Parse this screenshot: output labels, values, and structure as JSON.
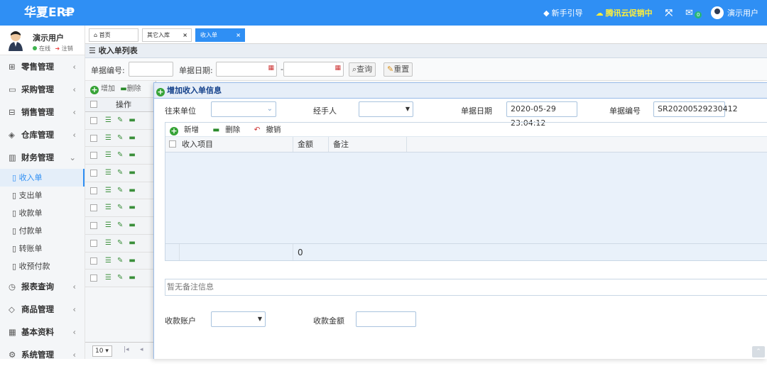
{
  "app": {
    "brand": "华夏ERP",
    "menu_toggle": "≡"
  },
  "topbar": {
    "guide": "新手引导",
    "promo": "腾讯云促销中",
    "mail_badge": "0",
    "user": "演示用户"
  },
  "user": {
    "name": "演示用户",
    "online": "在线",
    "logout": "注销"
  },
  "sidebar": {
    "groups": [
      {
        "label": "零售管理",
        "icon": "gift-icon",
        "glyph": "⊞"
      },
      {
        "label": "采购管理",
        "icon": "monitor-icon",
        "glyph": "▭"
      },
      {
        "label": "销售管理",
        "icon": "briefcase-icon",
        "glyph": "⊟"
      },
      {
        "label": "仓库管理",
        "icon": "layers-icon",
        "glyph": "◈"
      },
      {
        "label": "财务管理",
        "icon": "book-icon",
        "glyph": "▥"
      }
    ],
    "finance_items": [
      "收入单",
      "支出单",
      "收款单",
      "付款单",
      "转账单",
      "收预付款"
    ],
    "groups_after": [
      {
        "label": "报表查询",
        "icon": "clock-icon",
        "glyph": "◷"
      },
      {
        "label": "商品管理",
        "icon": "gem-icon",
        "glyph": "◇"
      },
      {
        "label": "基本资料",
        "icon": "grid-icon",
        "glyph": "▦"
      },
      {
        "label": "系统管理",
        "icon": "gear-icon",
        "glyph": "⚙"
      }
    ]
  },
  "tabs": [
    {
      "label": "首页",
      "icon": "home-icon"
    },
    {
      "label": "其它入库"
    },
    {
      "label": "收入单",
      "active": true
    }
  ],
  "page": {
    "title": "收入单列表",
    "search": {
      "bill_no_label": "单据编号:",
      "date_label": "单据日期:",
      "date_sep": "-",
      "query_btn": "查询",
      "reset_btn": "重置"
    },
    "grid": {
      "add": "增加",
      "delete": "删除",
      "col_op": "操作",
      "page_size": "10"
    }
  },
  "dialog": {
    "title": "增加收入单信息",
    "form": {
      "org_label": "往来单位",
      "handler_label": "经手人",
      "date_label": "单据日期",
      "date_value": "2020-05-29 23:04:12",
      "no_label": "单据编号",
      "no_value": "SR20200529230412"
    },
    "items": {
      "add": "新增",
      "delete": "删除",
      "undo": "撤销",
      "col_item": "收入项目",
      "col_amount": "金额",
      "col_remark": "备注",
      "footer_amount": "0"
    },
    "remark_placeholder": "暂无备注信息",
    "account_label": "收款账户",
    "amount_label": "收款金额"
  }
}
